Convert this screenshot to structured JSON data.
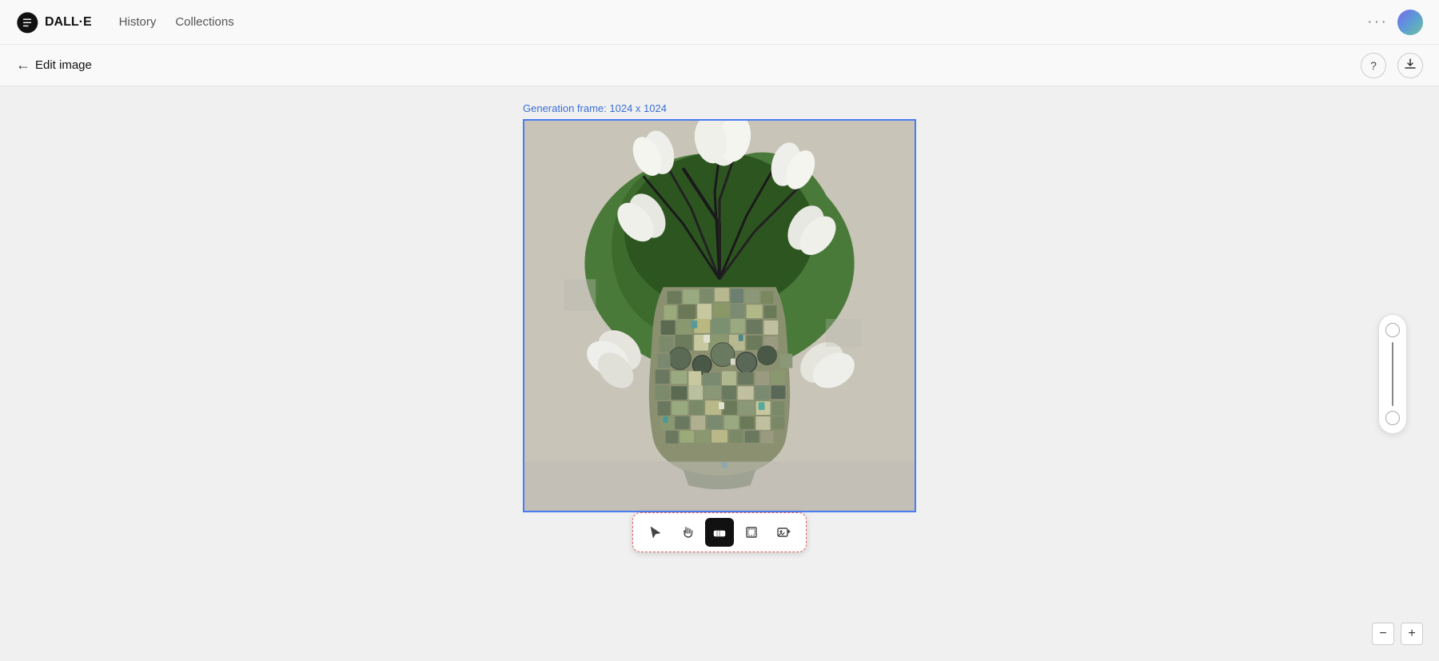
{
  "nav": {
    "logo_text": "DALL·E",
    "history_label": "History",
    "collections_label": "Collections",
    "more_icon": "···",
    "avatar_alt": "user-avatar"
  },
  "secondary_bar": {
    "back_label": "Edit image",
    "help_icon": "?",
    "download_icon": "↓"
  },
  "main": {
    "generation_frame_label": "Generation frame: 1024 x 1024"
  },
  "toolbar": {
    "pointer_icon": "↖",
    "hand_icon": "✋",
    "eraser_icon": "◻",
    "crop_icon": "⊡",
    "image_icon": "⊞"
  },
  "zoom": {
    "minus_label": "−",
    "plus_label": "+"
  }
}
